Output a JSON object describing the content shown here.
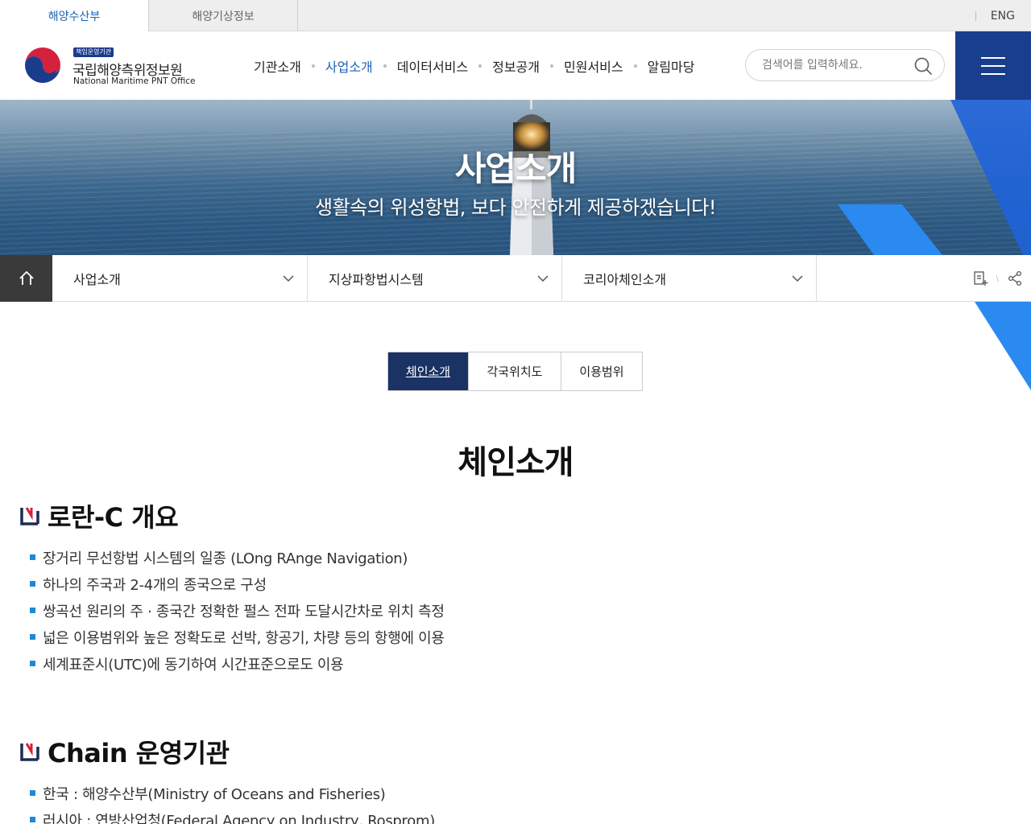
{
  "topbar": {
    "tabs": [
      {
        "label": "해양수산부",
        "active": true
      },
      {
        "label": "해양기상정보",
        "active": false
      }
    ],
    "lang_label": "ENG"
  },
  "header": {
    "logo": {
      "badge": "책임운영기관",
      "name_ko": "국립해양측위정보원",
      "name_en": "National Maritime PNT Office"
    },
    "nav": [
      {
        "label": "기관소개",
        "active": false
      },
      {
        "label": "사업소개",
        "active": true
      },
      {
        "label": "데이터서비스",
        "active": false
      },
      {
        "label": "정보공개",
        "active": false
      },
      {
        "label": "민원서비스",
        "active": false
      },
      {
        "label": "알림마당",
        "active": false
      }
    ],
    "search": {
      "placeholder": "검색어를 입력하세요.",
      "value": ""
    },
    "icons": {
      "search": "search-icon",
      "menu": "hamburger-icon"
    }
  },
  "hero": {
    "title": "사업소개",
    "subtitle": "생활속의 위성항법, 보다 안전하게 제공하겠습니다!"
  },
  "location": {
    "home_icon": "home-icon",
    "dropdowns": [
      {
        "label": "사업소개"
      },
      {
        "label": "지상파항법시스템"
      },
      {
        "label": "코리아체인소개"
      }
    ],
    "tools": [
      "print-icon",
      "share-icon"
    ]
  },
  "subtabs": [
    {
      "label": "체인소개",
      "active": true
    },
    {
      "label": "각국위치도",
      "active": false
    },
    {
      "label": "이용범위",
      "active": false
    }
  ],
  "content": {
    "page_title": "체인소개",
    "sections": [
      {
        "heading": "로란-C 개요",
        "bullets": [
          "장거리 무선항법 시스템의 일종 (LOng RAnge Navigation)",
          "하나의 주국과 2-4개의 종국으로 구성",
          "쌍곡선 원리의 주 · 종국간 정확한 펄스 전파 도달시간차로 위치 측정",
          "넓은 이용범위와 높은 정확도로 선박, 항공기, 차량 등의 항행에 이용",
          "세계표준시(UTC)에 동기하여 시간표준으로도 이용"
        ]
      },
      {
        "heading": "Chain 운영기관",
        "bullets": [
          "한국 : 해양수산부(Ministry of Oceans and Fisheries)",
          "러시아 : 연방산업청(Federal Agency on Industry, Rosprom)"
        ]
      }
    ]
  },
  "colors": {
    "brand_navy": "#1a3e8e",
    "accent_blue": "#1a62b7",
    "tab_active": "#1a3264",
    "bullet": "#1e88d6",
    "section_mark_red": "#d4213d"
  }
}
